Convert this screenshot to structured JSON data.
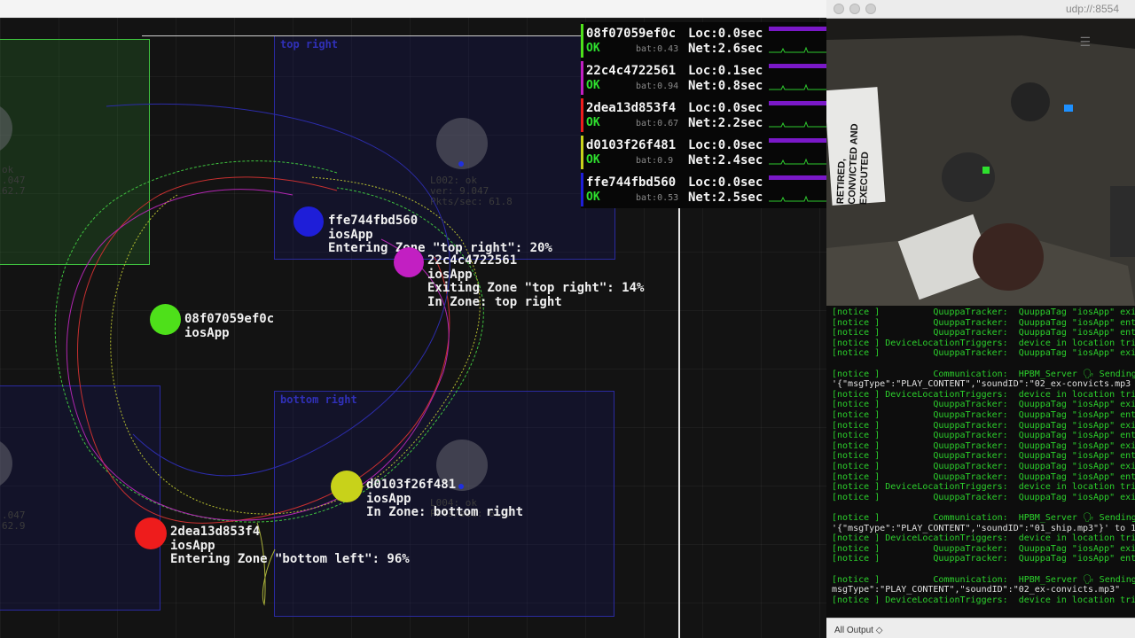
{
  "tracker": {
    "zones": [
      {
        "id": "zone-top-left",
        "label": ""
      },
      {
        "id": "zone-top-right",
        "label": "top right"
      },
      {
        "id": "zone-bottom-left",
        "label": ""
      },
      {
        "id": "zone-bottom-right",
        "label": "bottom right"
      }
    ],
    "locators": [
      {
        "info": "ok\n.047\n62.7"
      },
      {
        "info": "L002: ok\nver: 9.047\nPkts/sec: 61.8"
      },
      {
        "info": ".047\n62.9"
      },
      {
        "info": "L004: ok\nPkts/sec: 61.7"
      }
    ],
    "tags": [
      {
        "id": "ffe744fbd560",
        "app": "iosApp",
        "status": "Entering Zone \"top right\": 20%",
        "status2": "",
        "color": "#1e1ed8"
      },
      {
        "id": "22c4c4722561",
        "app": "iosApp",
        "status": "Exiting Zone \"top right\": 14%",
        "status2": "In Zone: top right",
        "color": "#c21fc2"
      },
      {
        "id": "08f07059ef0c",
        "app": "iosApp",
        "status": "",
        "status2": "",
        "color": "#4ee01a"
      },
      {
        "id": "d0103f26f481",
        "app": "iosApp",
        "status": "In Zone: bottom right",
        "status2": "",
        "color": "#c8d21a"
      },
      {
        "id": "2dea13d853f4",
        "app": "iosApp",
        "status": "Entering Zone \"bottom left\": 96%",
        "status2": "",
        "color": "#ee1c1c"
      }
    ]
  },
  "status_panel": [
    {
      "id": "08f07059ef0c",
      "loc": "Loc:0.0sec",
      "ok": "OK",
      "bat": "bat:0.43",
      "net": "Net:2.6sec",
      "color": "#4ee01a"
    },
    {
      "id": "22c4c4722561",
      "loc": "Loc:0.1sec",
      "ok": "OK",
      "bat": "bat:0.94",
      "net": "Net:0.8sec",
      "color": "#c21fc2"
    },
    {
      "id": "2dea13d853f4",
      "loc": "Loc:0.0sec",
      "ok": "OK",
      "bat": "bat:0.67",
      "net": "Net:2.2sec",
      "color": "#ee1c1c"
    },
    {
      "id": "d0103f26f481",
      "loc": "Loc:0.0sec",
      "ok": "OK",
      "bat": "bat:0.9",
      "net": "Net:2.4sec",
      "color": "#c8d21a"
    },
    {
      "id": "ffe744fbd560",
      "loc": "Loc:0.0sec",
      "ok": "OK",
      "bat": "bat:0.53",
      "net": "Net:2.5sec",
      "color": "#1e1ed8"
    }
  ],
  "video": {
    "title": "udp://:8554",
    "menu_icon": "hamburger-icon",
    "overlay_text": [
      "RETIRED,",
      "CONVICTED AND",
      "EXECUTED"
    ]
  },
  "console": {
    "lines": [
      "[notice ]          QuuppaTracker:  QuuppaTag \"iosApp\" exi",
      "[notice ]          QuuppaTracker:  QuuppaTag \"iosApp\" ent",
      "[notice ]          QuuppaTracker:  QuuppaTag \"iosApp\" ent",
      "[notice ] DeviceLocationTriggers:  device in location tri",
      "[notice ]          QuuppaTracker:  QuuppaTag \"iosApp\" exi",
      "",
      "[notice ]          Communication:  HPBM_Server 🗣 Sending",
      "'{\"msgType\":\"PLAY_CONTENT\",\"soundID\":\"02_ex-convicts.mp3",
      "[notice ] DeviceLocationTriggers:  device in location tri",
      "[notice ]          QuuppaTracker:  QuuppaTag \"iosApp\" exi",
      "[notice ]          QuuppaTracker:  QuuppaTag \"iosApp\" ent",
      "[notice ]          QuuppaTracker:  QuuppaTag \"iosApp\" exi",
      "[notice ]          QuuppaTracker:  QuuppaTag \"iosApp\" ent",
      "[notice ]          QuuppaTracker:  QuuppaTag \"iosApp\" exi",
      "[notice ]          QuuppaTracker:  QuuppaTag \"iosApp\" ent",
      "[notice ]          QuuppaTracker:  QuuppaTag \"iosApp\" exi",
      "[notice ]          QuuppaTracker:  QuuppaTag \"iosApp\" ent",
      "[notice ] DeviceLocationTriggers:  device in location tri",
      "[notice ]          QuuppaTracker:  QuuppaTag \"iosApp\" exi",
      "",
      "[notice ]          Communication:  HPBM_Server 🗣 Sending",
      "'{\"msgType\":\"PLAY_CONTENT\",\"soundID\":\"01_ship.mp3\"}' to 1",
      "[notice ] DeviceLocationTriggers:  device in location tri",
      "[notice ]          QuuppaTracker:  QuuppaTag \"iosApp\" exi",
      "[notice ]          QuuppaTracker:  QuuppaTag \"iosApp\" ent",
      "",
      "[notice ]          Communication:  HPBM_Server 🗣 Sending",
      "msgType\":\"PLAY_CONTENT\",\"soundID\":\"02_ex-convicts.mp3\"",
      "[notice ] DeviceLocationTriggers:  device in location tri"
    ],
    "filter_label": "All Output ◇"
  }
}
